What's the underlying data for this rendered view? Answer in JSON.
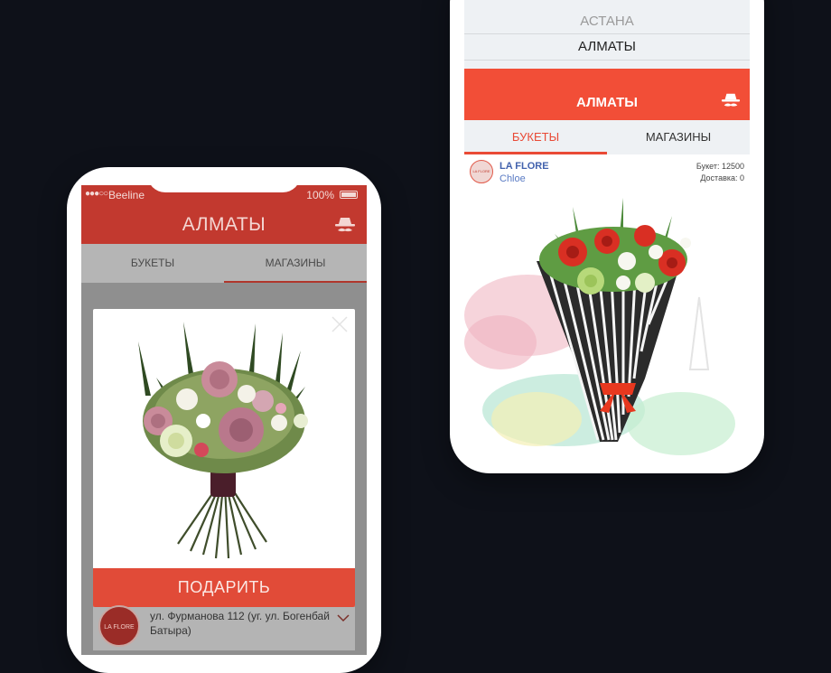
{
  "left_phone": {
    "status": {
      "signal": "●●●○○",
      "carrier": "Beeline",
      "battery": "100%"
    },
    "header": {
      "title": "АЛМАТЫ",
      "icon": "spy-icon"
    },
    "tabs": [
      {
        "label": "БУКЕТЫ"
      },
      {
        "label": "МАГАЗИНЫ"
      }
    ],
    "modal": {
      "close_icon": "close-icon",
      "gift_label": "ПОДАРИТЬ"
    },
    "shop": {
      "logo_text": "LA FLORE",
      "address": "ул. Фурманова 112 (уг. ул. Богенбай Батыра)"
    }
  },
  "right_phone": {
    "city_picker": {
      "options": [
        {
          "label": "АСТАНА"
        },
        {
          "label": "АЛМАТЫ"
        }
      ]
    },
    "header": {
      "title": "АЛМАТЫ",
      "icon": "spy-icon"
    },
    "tabs": [
      {
        "label": "БУКЕТЫ",
        "active": true
      },
      {
        "label": "МАГАЗИНЫ",
        "active": false
      }
    ],
    "card": {
      "logo_text": "LA FLORE",
      "shop_name": "LA FLORE",
      "bouquet_name": "Chloe",
      "price": "Букет: 12500",
      "delivery": "Доставка: 0"
    }
  },
  "colors": {
    "background": "#0e1119",
    "accent": "#f24e37",
    "accent_dim": "#c2392f",
    "link": "#4262ad"
  }
}
